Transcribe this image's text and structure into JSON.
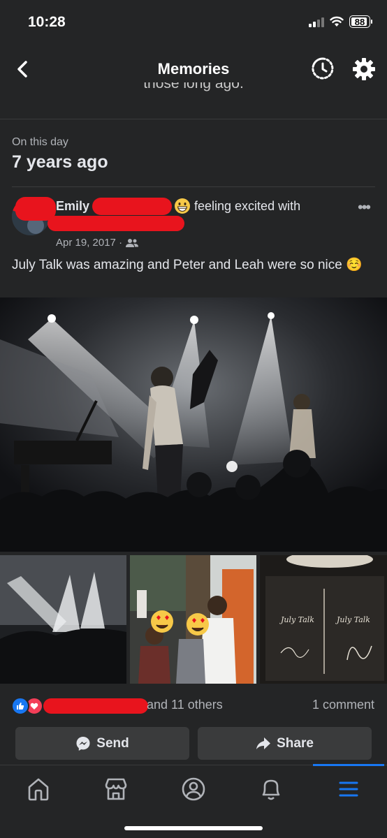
{
  "status_bar": {
    "time": "10:28",
    "battery": "88"
  },
  "nav": {
    "title": "Memories",
    "back_icon": "chevron-left-icon",
    "history_icon": "history-icon",
    "settings_icon": "gear-icon"
  },
  "cut_text": "those long ago.",
  "memory": {
    "label": "On this day",
    "years": "7 years ago"
  },
  "post": {
    "author": "Emily",
    "feeling": "feeling excited with",
    "date": "Apr 19, 2017 ·",
    "text": "July Talk was amazing and Peter and Leah were so nice ☺️",
    "more_icon": "more-icon"
  },
  "photos": {
    "main": "concert-photo",
    "thumbs": [
      "concert-thumb",
      "group-photo",
      "signed-poster"
    ],
    "poster_text_left": "July Talk",
    "poster_text_right": "July Talk"
  },
  "engagement": {
    "reactions_suffix": "and 11 others",
    "comments": "1 comment"
  },
  "actions": {
    "send": "Send",
    "share": "Share"
  },
  "tabs": [
    "home",
    "marketplace",
    "profile",
    "notifications",
    "menu"
  ],
  "colors": {
    "accent": "#1877f2",
    "background": "#242526",
    "redaction": "#e8141d",
    "love": "#f33e58"
  }
}
